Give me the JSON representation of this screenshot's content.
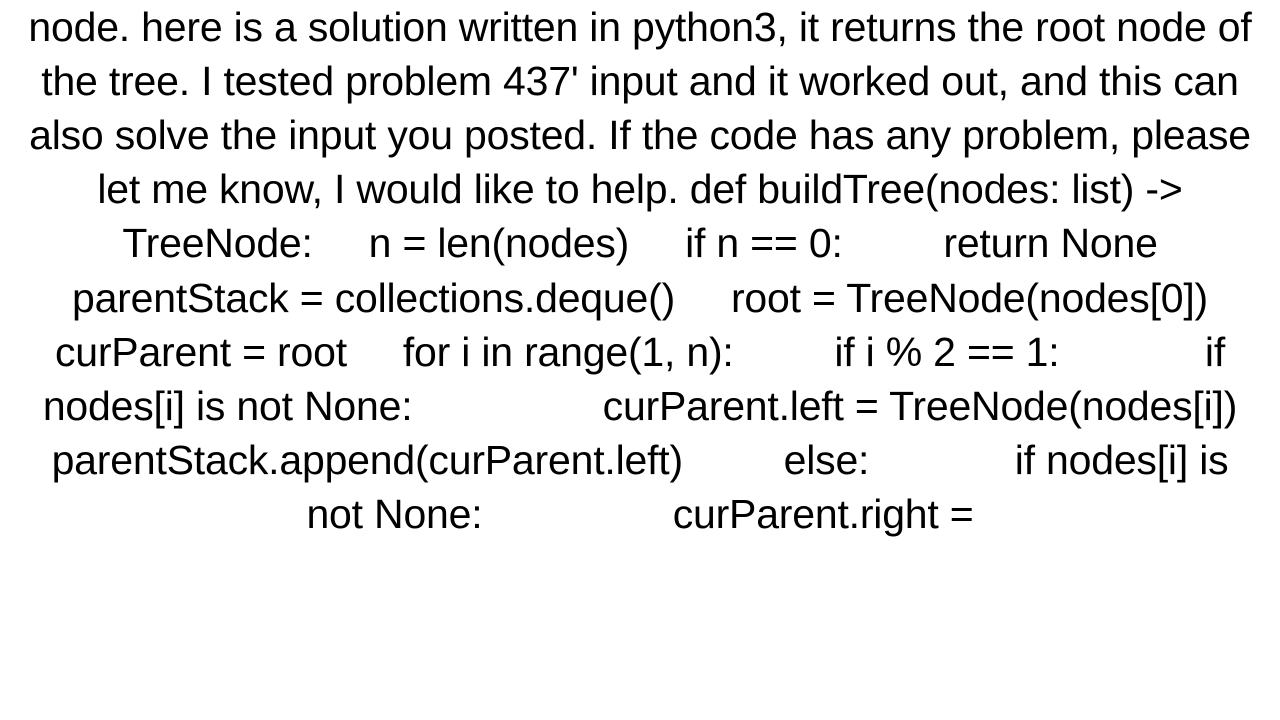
{
  "document": {
    "text": "node. here is a solution written in python3, it returns the root node of the tree. I tested problem 437' input and it worked out, and this can also solve the input you posted. If the code has any problem, please let me know, I would like to help. def buildTree(nodes: list) -> TreeNode:     n = len(nodes)     if n == 0:         return None     parentStack = collections.deque()     root = TreeNode(nodes[0])     curParent = root     for i in range(1, n):         if i % 2 == 1:             if nodes[i] is not None:                 curParent.left = TreeNode(nodes[i])                 parentStack.append(curParent.left)         else:             if nodes[i] is not None:                 curParent.right ="
  }
}
